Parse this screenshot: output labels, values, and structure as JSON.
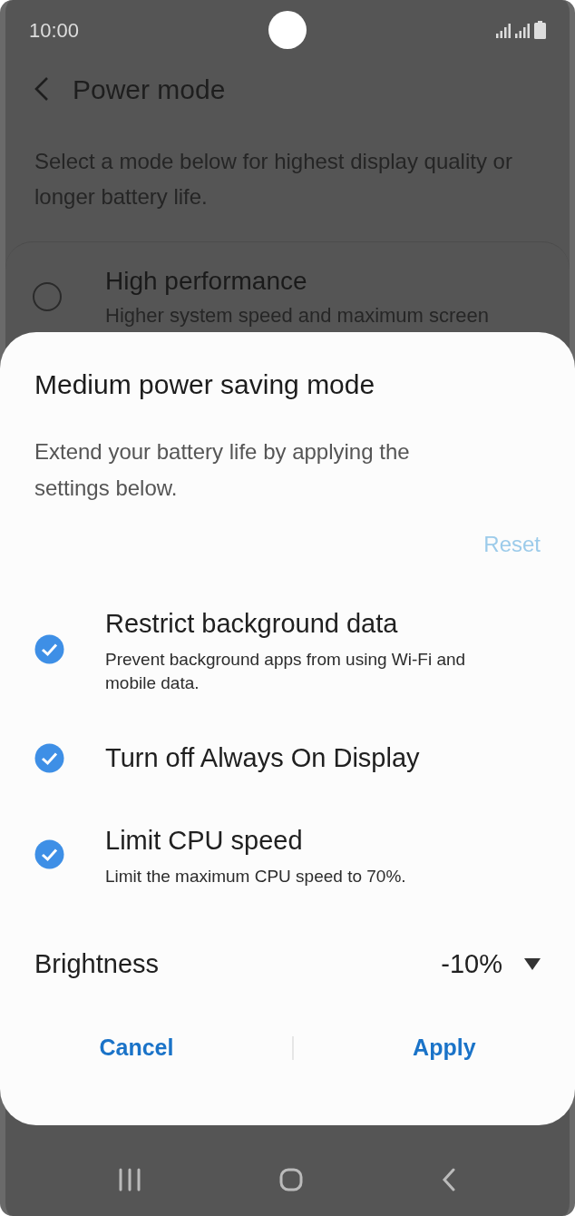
{
  "status_bar": {
    "time": "10:00"
  },
  "header": {
    "title": "Power mode"
  },
  "description": "Select a mode below for highest display quality or longer battery life.",
  "modes": [
    {
      "title": "High performance",
      "subtitle": "Higher system speed and maximum screen",
      "selected": false
    }
  ],
  "dialog": {
    "title": "Medium power saving mode",
    "description": "Extend your battery life by applying the settings below.",
    "reset": {
      "label": "Reset",
      "disabled": true
    },
    "options": [
      {
        "title": "Restrict background data",
        "subtitle": "Prevent background apps from using Wi-Fi and mobile data.",
        "checked": true
      },
      {
        "title": "Turn off Always On Display",
        "checked": true
      },
      {
        "title": "Limit CPU speed",
        "subtitle": "Limit the maximum CPU speed to 70%.",
        "checked": true
      }
    ],
    "brightness": {
      "label": "Brightness",
      "value": "-10%"
    },
    "buttons": [
      {
        "label": "Cancel"
      },
      {
        "label": "Apply"
      }
    ]
  }
}
